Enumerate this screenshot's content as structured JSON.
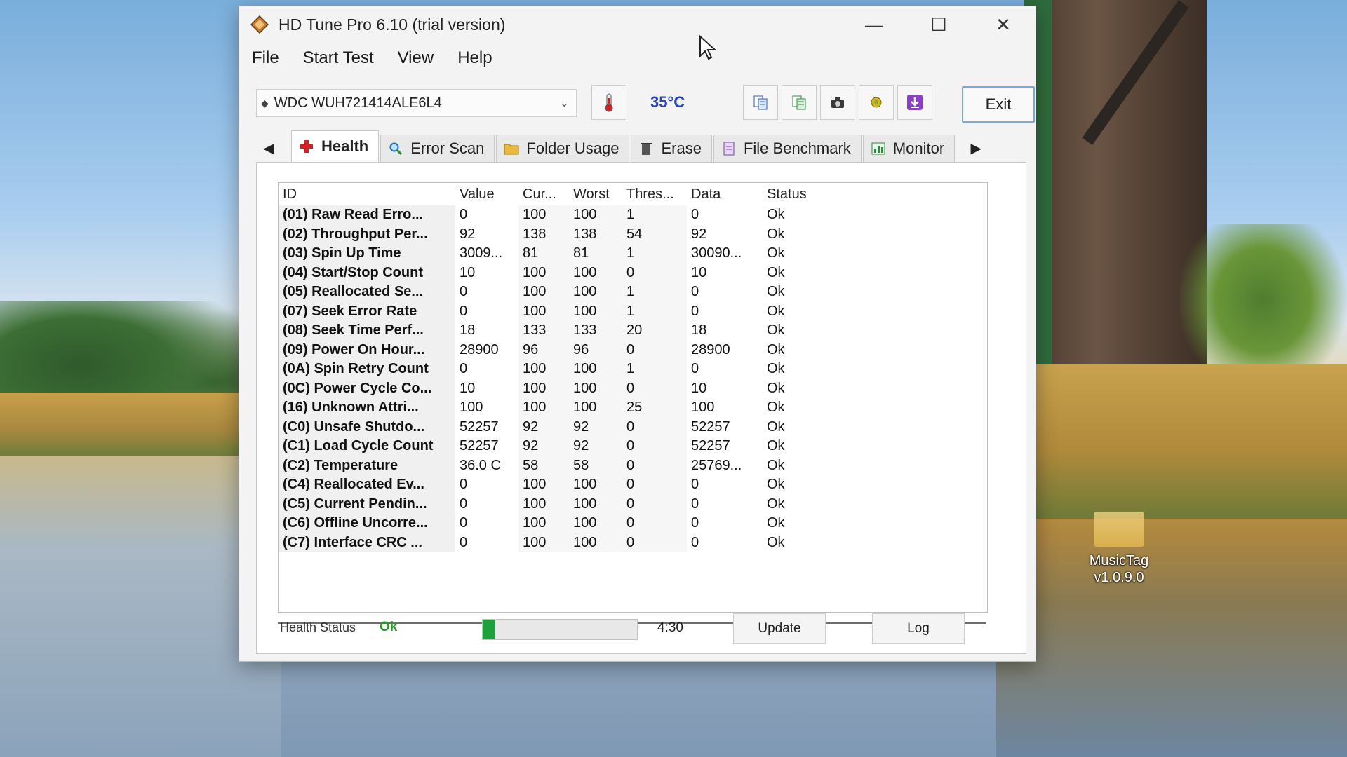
{
  "desktop": {
    "icon_label_line1": "MusicTag",
    "icon_label_line2": "v1.0.9.0"
  },
  "window": {
    "title": "HD Tune Pro 6.10 (trial version)",
    "controls": {
      "minimize": "—",
      "maximize": "☐",
      "close": "✕"
    }
  },
  "menu": {
    "file": "File",
    "start_test": "Start Test",
    "view": "View",
    "help": "Help"
  },
  "toolbar": {
    "drive": "WDC  WUH721414ALE6L4",
    "temperature": "35°C",
    "exit": "Exit",
    "icons": [
      "thermometer-icon",
      "copy-info-icon",
      "copy-all-icon",
      "screenshot-icon",
      "options-icon",
      "save-icon"
    ]
  },
  "tabs": [
    {
      "label": "Health",
      "icon": "red-cross-icon",
      "active": true
    },
    {
      "label": "Error Scan",
      "icon": "magnifier-icon"
    },
    {
      "label": "Folder Usage",
      "icon": "folder-icon"
    },
    {
      "label": "Erase",
      "icon": "trash-icon"
    },
    {
      "label": "File Benchmark",
      "icon": "file-benchmark-icon"
    },
    {
      "label": "Monitor",
      "icon": "monitor-chart-icon"
    }
  ],
  "table": {
    "columns": [
      "ID",
      "Value",
      "Cur...",
      "Worst",
      "Thres...",
      "Data",
      "Status"
    ],
    "rows": [
      [
        "(01) Raw Read Erro...",
        "0",
        "100",
        "100",
        "1",
        "0",
        "Ok"
      ],
      [
        "(02) Throughput Per...",
        "92",
        "138",
        "138",
        "54",
        "92",
        "Ok"
      ],
      [
        "(03) Spin Up Time",
        "3009...",
        "81",
        "81",
        "1",
        "30090...",
        "Ok"
      ],
      [
        "(04) Start/Stop Count",
        "10",
        "100",
        "100",
        "0",
        "10",
        "Ok"
      ],
      [
        "(05) Reallocated Se...",
        "0",
        "100",
        "100",
        "1",
        "0",
        "Ok"
      ],
      [
        "(07) Seek Error Rate",
        "0",
        "100",
        "100",
        "1",
        "0",
        "Ok"
      ],
      [
        "(08) Seek Time Perf...",
        "18",
        "133",
        "133",
        "20",
        "18",
        "Ok"
      ],
      [
        "(09) Power On Hour...",
        "28900",
        "96",
        "96",
        "0",
        "28900",
        "Ok"
      ],
      [
        "(0A) Spin Retry Count",
        "0",
        "100",
        "100",
        "1",
        "0",
        "Ok"
      ],
      [
        "(0C) Power Cycle Co...",
        "10",
        "100",
        "100",
        "0",
        "10",
        "Ok"
      ],
      [
        "(16) Unknown Attri...",
        "100",
        "100",
        "100",
        "25",
        "100",
        "Ok"
      ],
      [
        "(C0) Unsafe Shutdo...",
        "52257",
        "92",
        "92",
        "0",
        "52257",
        "Ok"
      ],
      [
        "(C1) Load Cycle Count",
        "52257",
        "92",
        "92",
        "0",
        "52257",
        "Ok"
      ],
      [
        "(C2) Temperature",
        "36.0 C",
        "58",
        "58",
        "0",
        "25769...",
        "Ok"
      ],
      [
        "(C4) Reallocated Ev...",
        "0",
        "100",
        "100",
        "0",
        "0",
        "Ok"
      ],
      [
        "(C5) Current Pendin...",
        "0",
        "100",
        "100",
        "0",
        "0",
        "Ok"
      ],
      [
        "(C6) Offline Uncorre...",
        "0",
        "100",
        "100",
        "0",
        "0",
        "Ok"
      ],
      [
        "(C7) Interface CRC ...",
        "0",
        "100",
        "100",
        "0",
        "0",
        "Ok"
      ]
    ]
  },
  "status": {
    "health_label": "Health Status",
    "health_value": "Ok",
    "progress_fraction": 0.08,
    "timer": "4:30",
    "update": "Update",
    "log": "Log"
  },
  "colors": {
    "temp": "#2b46b8",
    "ok_green": "#2a9a2a",
    "progress": "#1ea03a"
  }
}
